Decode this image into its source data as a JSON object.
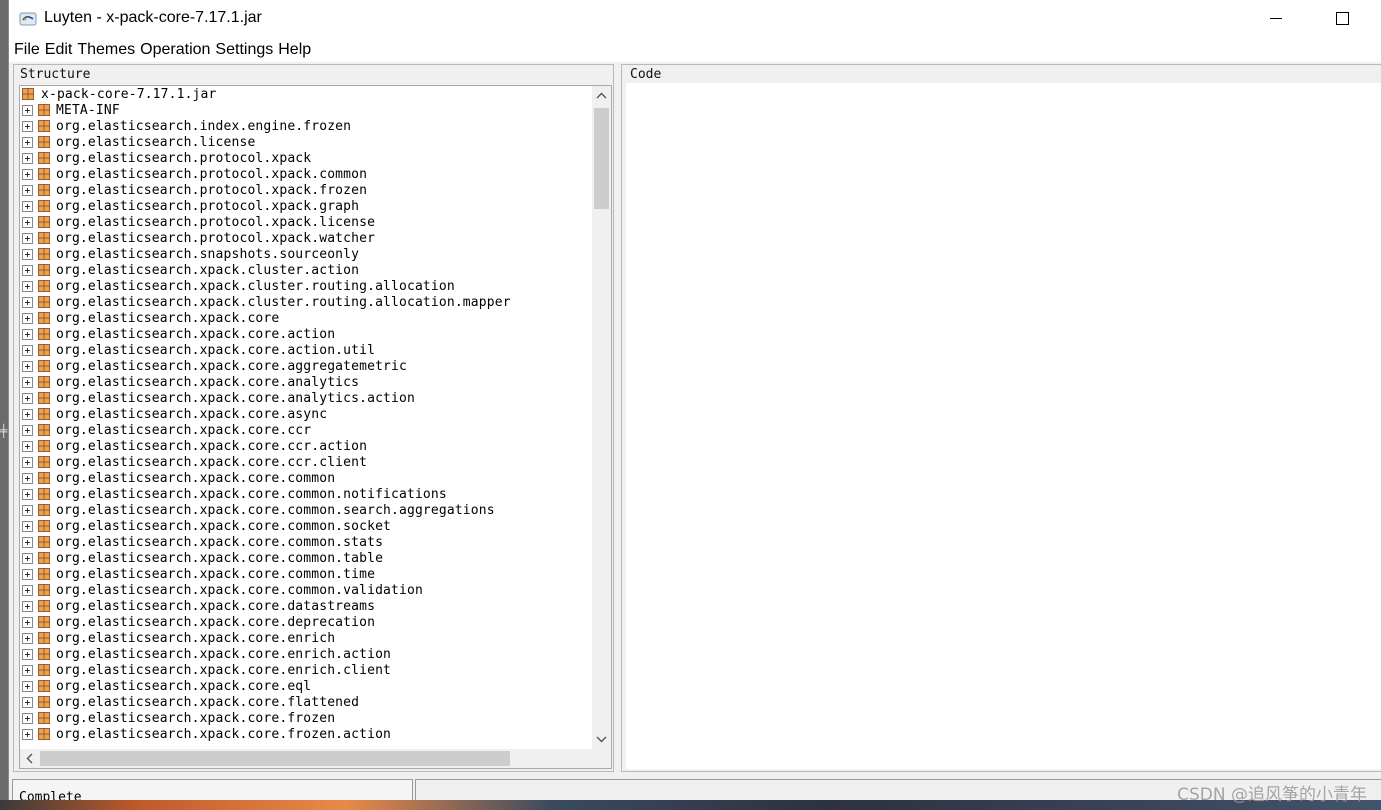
{
  "window": {
    "title": "Luyten - x-pack-core-7.17.1.jar"
  },
  "menu": [
    "File",
    "Edit",
    "Themes",
    "Operation",
    "Settings",
    "Help"
  ],
  "structure": {
    "label": "Structure",
    "root": "x-pack-core-7.17.1.jar",
    "items": [
      "META-INF",
      "org.elasticsearch.index.engine.frozen",
      "org.elasticsearch.license",
      "org.elasticsearch.protocol.xpack",
      "org.elasticsearch.protocol.xpack.common",
      "org.elasticsearch.protocol.xpack.frozen",
      "org.elasticsearch.protocol.xpack.graph",
      "org.elasticsearch.protocol.xpack.license",
      "org.elasticsearch.protocol.xpack.watcher",
      "org.elasticsearch.snapshots.sourceonly",
      "org.elasticsearch.xpack.cluster.action",
      "org.elasticsearch.xpack.cluster.routing.allocation",
      "org.elasticsearch.xpack.cluster.routing.allocation.mapper",
      "org.elasticsearch.xpack.core",
      "org.elasticsearch.xpack.core.action",
      "org.elasticsearch.xpack.core.action.util",
      "org.elasticsearch.xpack.core.aggregatemetric",
      "org.elasticsearch.xpack.core.analytics",
      "org.elasticsearch.xpack.core.analytics.action",
      "org.elasticsearch.xpack.core.async",
      "org.elasticsearch.xpack.core.ccr",
      "org.elasticsearch.xpack.core.ccr.action",
      "org.elasticsearch.xpack.core.ccr.client",
      "org.elasticsearch.xpack.core.common",
      "org.elasticsearch.xpack.core.common.notifications",
      "org.elasticsearch.xpack.core.common.search.aggregations",
      "org.elasticsearch.xpack.core.common.socket",
      "org.elasticsearch.xpack.core.common.stats",
      "org.elasticsearch.xpack.core.common.table",
      "org.elasticsearch.xpack.core.common.time",
      "org.elasticsearch.xpack.core.common.validation",
      "org.elasticsearch.xpack.core.datastreams",
      "org.elasticsearch.xpack.core.deprecation",
      "org.elasticsearch.xpack.core.enrich",
      "org.elasticsearch.xpack.core.enrich.action",
      "org.elasticsearch.xpack.core.enrich.client",
      "org.elasticsearch.xpack.core.eql",
      "org.elasticsearch.xpack.core.flattened",
      "org.elasticsearch.xpack.core.frozen",
      "org.elasticsearch.xpack.core.frozen.action"
    ]
  },
  "code": {
    "label": "Code"
  },
  "status": {
    "text": "Complete"
  },
  "watermark": "CSDN @追风筝的小青年",
  "colors": {
    "package_icon": "#e8a15a",
    "package_icon_line": "#a7581c"
  }
}
